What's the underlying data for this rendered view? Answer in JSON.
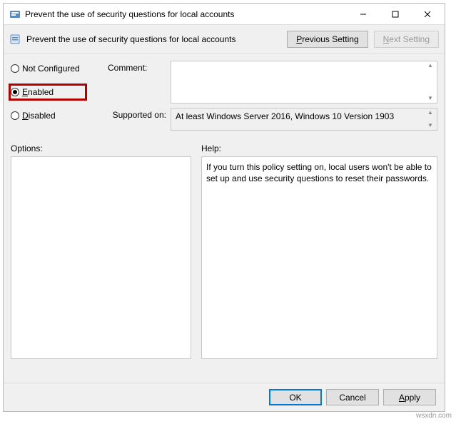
{
  "window": {
    "title": "Prevent the use of security questions for local accounts"
  },
  "toolbar": {
    "title": "Prevent the use of security questions for local accounts",
    "prev_label": "Previous Setting",
    "next_label": "Next Setting"
  },
  "radios": {
    "not_configured": "Not Configured",
    "enabled": "Enabled",
    "disabled": "Disabled",
    "selected": "enabled"
  },
  "labels": {
    "comment": "Comment:",
    "supported_on": "Supported on:",
    "options": "Options:",
    "help": "Help:"
  },
  "fields": {
    "comment_value": "",
    "supported_value": "At least Windows Server 2016, Windows 10 Version 1903",
    "options_value": "",
    "help_value": "If you turn this policy setting on, local users won't be able to set up and use security questions to reset their passwords."
  },
  "buttons": {
    "ok": "OK",
    "cancel": "Cancel",
    "apply": "Apply"
  },
  "watermark": "wsxdn.com"
}
